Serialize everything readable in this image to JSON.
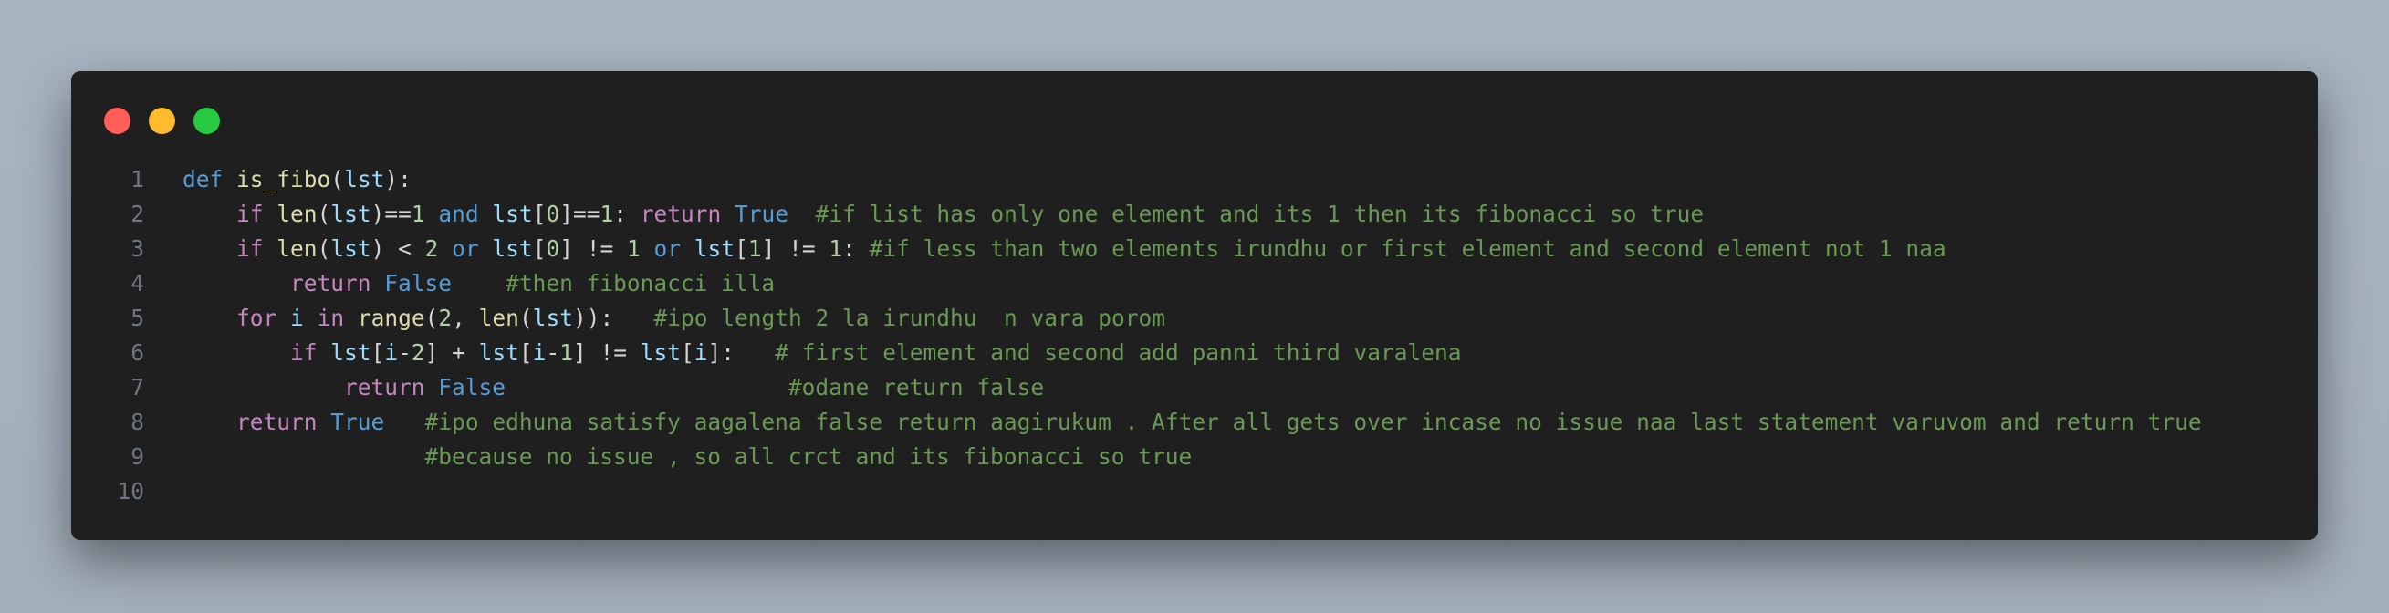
{
  "window": {
    "controls": [
      {
        "name": "close",
        "color": "#ff5f57"
      },
      {
        "name": "minimize",
        "color": "#febc2e"
      },
      {
        "name": "maximize",
        "color": "#28c840"
      }
    ]
  },
  "editor": {
    "lines": [
      {
        "n": "1",
        "tokens": [
          {
            "t": "kw",
            "v": "def"
          },
          {
            "t": "pu",
            "v": " "
          },
          {
            "t": "fn",
            "v": "is_fibo"
          },
          {
            "t": "pu",
            "v": "("
          },
          {
            "t": "var",
            "v": "lst"
          },
          {
            "t": "pu",
            "v": "):"
          }
        ]
      },
      {
        "n": "2",
        "tokens": [
          {
            "t": "pu",
            "v": "    "
          },
          {
            "t": "ctl",
            "v": "if"
          },
          {
            "t": "pu",
            "v": " "
          },
          {
            "t": "fn",
            "v": "len"
          },
          {
            "t": "pu",
            "v": "("
          },
          {
            "t": "var",
            "v": "lst"
          },
          {
            "t": "pu",
            "v": ")=="
          },
          {
            "t": "num",
            "v": "1"
          },
          {
            "t": "pu",
            "v": " "
          },
          {
            "t": "kw",
            "v": "and"
          },
          {
            "t": "pu",
            "v": " "
          },
          {
            "t": "var",
            "v": "lst"
          },
          {
            "t": "pu",
            "v": "["
          },
          {
            "t": "num",
            "v": "0"
          },
          {
            "t": "pu",
            "v": "]=="
          },
          {
            "t": "num",
            "v": "1"
          },
          {
            "t": "pu",
            "v": ": "
          },
          {
            "t": "ctl",
            "v": "return"
          },
          {
            "t": "pu",
            "v": " "
          },
          {
            "t": "bool",
            "v": "True"
          },
          {
            "t": "pu",
            "v": "  "
          },
          {
            "t": "com",
            "v": "#if list has only one element and its 1 then its fibonacci so true"
          }
        ]
      },
      {
        "n": "3",
        "tokens": [
          {
            "t": "pu",
            "v": "    "
          },
          {
            "t": "ctl",
            "v": "if"
          },
          {
            "t": "pu",
            "v": " "
          },
          {
            "t": "fn",
            "v": "len"
          },
          {
            "t": "pu",
            "v": "("
          },
          {
            "t": "var",
            "v": "lst"
          },
          {
            "t": "pu",
            "v": ") < "
          },
          {
            "t": "num",
            "v": "2"
          },
          {
            "t": "pu",
            "v": " "
          },
          {
            "t": "kw",
            "v": "or"
          },
          {
            "t": "pu",
            "v": " "
          },
          {
            "t": "var",
            "v": "lst"
          },
          {
            "t": "pu",
            "v": "["
          },
          {
            "t": "num",
            "v": "0"
          },
          {
            "t": "pu",
            "v": "] != "
          },
          {
            "t": "num",
            "v": "1"
          },
          {
            "t": "pu",
            "v": " "
          },
          {
            "t": "kw",
            "v": "or"
          },
          {
            "t": "pu",
            "v": " "
          },
          {
            "t": "var",
            "v": "lst"
          },
          {
            "t": "pu",
            "v": "["
          },
          {
            "t": "num",
            "v": "1"
          },
          {
            "t": "pu",
            "v": "] != "
          },
          {
            "t": "num",
            "v": "1"
          },
          {
            "t": "pu",
            "v": ": "
          },
          {
            "t": "com",
            "v": "#if less than two elements irundhu or first element and second element not 1 naa"
          }
        ]
      },
      {
        "n": "4",
        "tokens": [
          {
            "t": "pu",
            "v": "        "
          },
          {
            "t": "ctl",
            "v": "return"
          },
          {
            "t": "pu",
            "v": " "
          },
          {
            "t": "bool",
            "v": "False"
          },
          {
            "t": "pu",
            "v": "    "
          },
          {
            "t": "com",
            "v": "#then fibonacci illa"
          }
        ]
      },
      {
        "n": "5",
        "tokens": [
          {
            "t": "pu",
            "v": "    "
          },
          {
            "t": "ctl",
            "v": "for"
          },
          {
            "t": "pu",
            "v": " "
          },
          {
            "t": "var",
            "v": "i"
          },
          {
            "t": "pu",
            "v": " "
          },
          {
            "t": "ctl",
            "v": "in"
          },
          {
            "t": "pu",
            "v": " "
          },
          {
            "t": "fn",
            "v": "range"
          },
          {
            "t": "pu",
            "v": "("
          },
          {
            "t": "num",
            "v": "2"
          },
          {
            "t": "pu",
            "v": ", "
          },
          {
            "t": "fn",
            "v": "len"
          },
          {
            "t": "pu",
            "v": "("
          },
          {
            "t": "var",
            "v": "lst"
          },
          {
            "t": "pu",
            "v": ")):   "
          },
          {
            "t": "com",
            "v": "#ipo length 2 la irundhu  n vara porom"
          }
        ]
      },
      {
        "n": "6",
        "tokens": [
          {
            "t": "pu",
            "v": "        "
          },
          {
            "t": "ctl",
            "v": "if"
          },
          {
            "t": "pu",
            "v": " "
          },
          {
            "t": "var",
            "v": "lst"
          },
          {
            "t": "pu",
            "v": "["
          },
          {
            "t": "var",
            "v": "i"
          },
          {
            "t": "pu",
            "v": "-"
          },
          {
            "t": "num",
            "v": "2"
          },
          {
            "t": "pu",
            "v": "] + "
          },
          {
            "t": "var",
            "v": "lst"
          },
          {
            "t": "pu",
            "v": "["
          },
          {
            "t": "var",
            "v": "i"
          },
          {
            "t": "pu",
            "v": "-"
          },
          {
            "t": "num",
            "v": "1"
          },
          {
            "t": "pu",
            "v": "] != "
          },
          {
            "t": "var",
            "v": "lst"
          },
          {
            "t": "pu",
            "v": "["
          },
          {
            "t": "var",
            "v": "i"
          },
          {
            "t": "pu",
            "v": "]:   "
          },
          {
            "t": "com",
            "v": "# first element and second add panni third varalena"
          }
        ]
      },
      {
        "n": "7",
        "tokens": [
          {
            "t": "pu",
            "v": "            "
          },
          {
            "t": "ctl",
            "v": "return"
          },
          {
            "t": "pu",
            "v": " "
          },
          {
            "t": "bool",
            "v": "False"
          },
          {
            "t": "pu",
            "v": "                     "
          },
          {
            "t": "com",
            "v": "#odane return false"
          }
        ]
      },
      {
        "n": "8",
        "tokens": [
          {
            "t": "pu",
            "v": "    "
          },
          {
            "t": "ctl",
            "v": "return"
          },
          {
            "t": "pu",
            "v": " "
          },
          {
            "t": "bool",
            "v": "True"
          },
          {
            "t": "pu",
            "v": "   "
          },
          {
            "t": "com",
            "v": "#ipo edhuna satisfy aagalena false return aagirukum . After all gets over incase no issue naa last statement varuvom and return true"
          }
        ]
      },
      {
        "n": "9",
        "tokens": [
          {
            "t": "pu",
            "v": "                  "
          },
          {
            "t": "com",
            "v": "#because no issue , so all crct and its fibonacci so true"
          }
        ]
      },
      {
        "n": "10",
        "tokens": []
      }
    ]
  }
}
